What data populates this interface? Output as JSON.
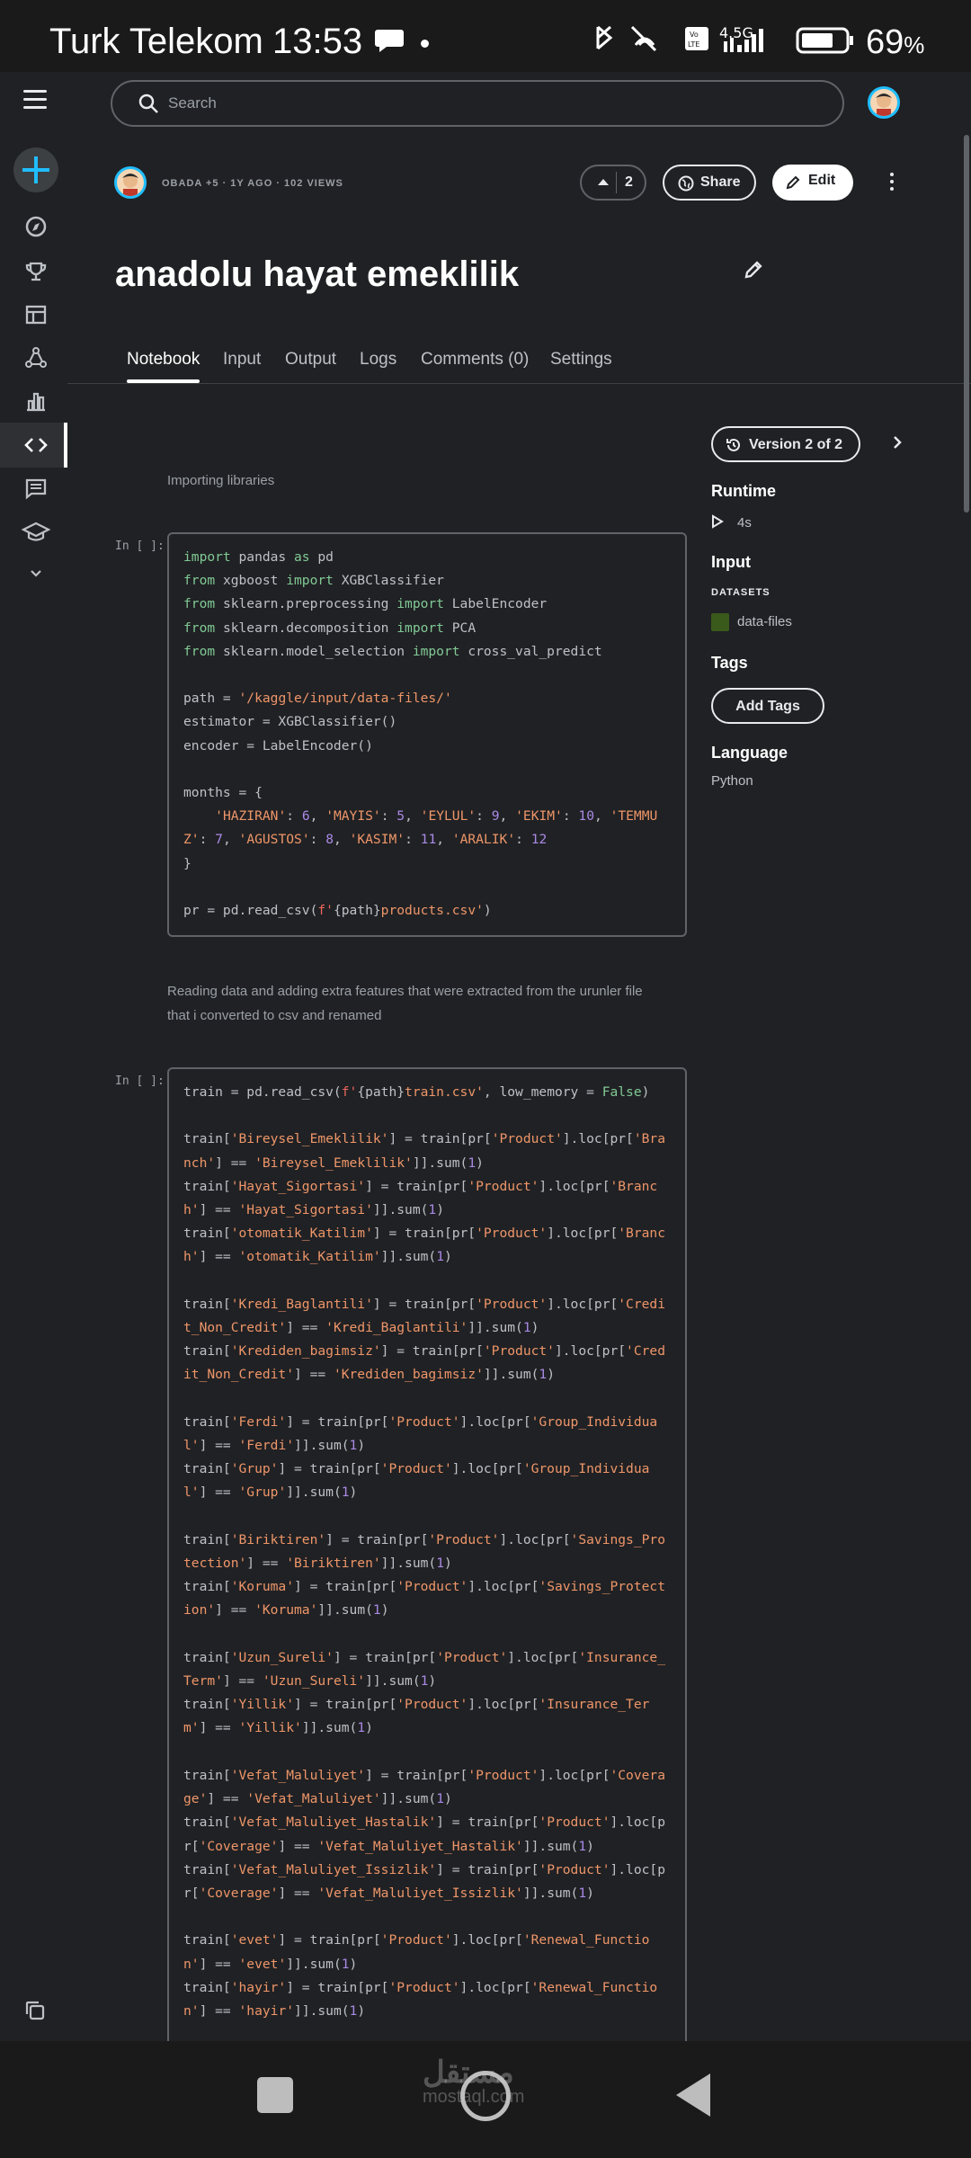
{
  "status_bar": {
    "carrier": "Turk Telekom",
    "time": "13:53",
    "network": "4.5G",
    "volte": "Vo LTE",
    "battery_percent": "69",
    "battery_unit": "%"
  },
  "header": {
    "search_placeholder": "Search"
  },
  "notebook": {
    "meta": "OBADA +5 · 1Y AGO · 102 VIEWS",
    "vote_count": "2",
    "share_label": "Share",
    "edit_label": "Edit",
    "title": "anadolu hayat emeklilik",
    "tabs": [
      "Notebook",
      "Input",
      "Output",
      "Logs",
      "Comments (0)",
      "Settings"
    ],
    "active_tab": "Notebook"
  },
  "cells": {
    "md1": "Importing libraries",
    "prompt1": "In [ ]:",
    "md2_line1": "Reading data and adding extra features that were extracted from the urunler file",
    "md2_line2": "that i converted to csv and renamed",
    "prompt2": "In [ ]:"
  },
  "right_panel": {
    "version_label": "Version 2 of 2",
    "runtime_heading": "Runtime",
    "runtime_value": "4s",
    "input_heading": "Input",
    "datasets_label": "DATASETS",
    "dataset_name": "data-files",
    "tags_heading": "Tags",
    "add_tags_label": "Add Tags",
    "language_heading": "Language",
    "language_value": "Python"
  },
  "watermark": {
    "arabic": "مستقل",
    "latin": "mostaql.com"
  },
  "colors": {
    "accent": "#20beff",
    "background": "#202124",
    "keyword": "#81c995",
    "string": "#ee9669",
    "number": "#a98ae6"
  }
}
